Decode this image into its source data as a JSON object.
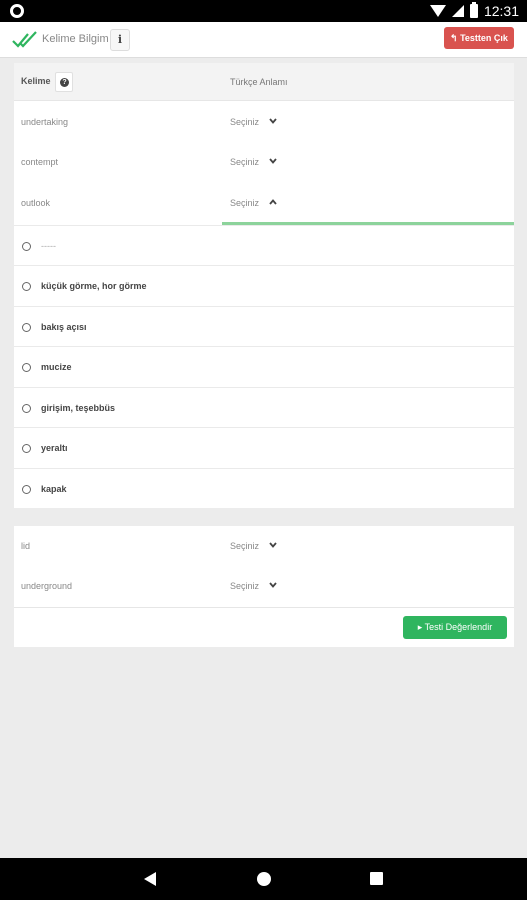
{
  "status": {
    "time": "12:31"
  },
  "appbar": {
    "title": "Kelime Bilgim",
    "info_label": "i",
    "exit_label": "Testten Çık"
  },
  "table": {
    "col_word": "Kelime",
    "col_meaning": "Türkçe Anlamı",
    "help_icon": "?",
    "rows": [
      {
        "word": "undertaking",
        "select": "Seçiniz"
      },
      {
        "word": "contempt",
        "select": "Seçiniz"
      },
      {
        "word": "outlook",
        "select": "Seçiniz"
      }
    ],
    "options": [
      "-----",
      "küçük görme, hor görme",
      "bakış açısı",
      "mucize",
      "girişim, teşebbüs",
      "yeraltı",
      "kapak"
    ]
  },
  "table2": {
    "rows": [
      {
        "word": "lid",
        "select": "Seçiniz"
      },
      {
        "word": "underground",
        "select": "Seçiniz"
      }
    ],
    "evaluate_label": "Testi Değerlendir"
  },
  "colors": {
    "exit": "#d9534f",
    "evaluate": "#2fb55f",
    "active_underline": "#8cd39b"
  }
}
